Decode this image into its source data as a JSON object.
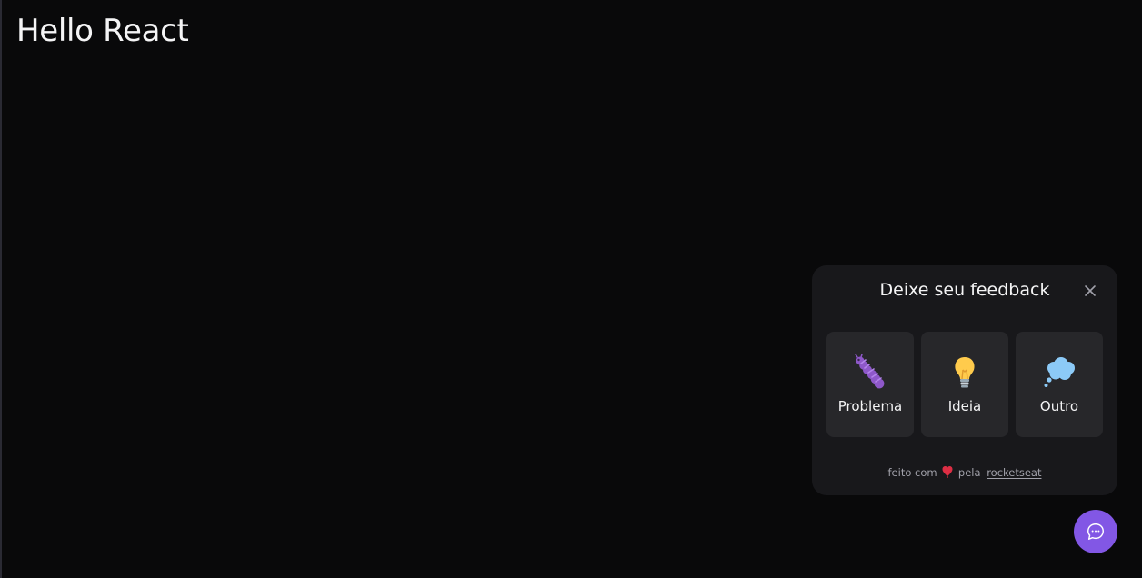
{
  "page": {
    "title": "Hello React"
  },
  "widget": {
    "title": "Deixe seu feedback",
    "options": [
      {
        "label": "Problema",
        "icon": "bug-icon"
      },
      {
        "label": "Ideia",
        "icon": "lightbulb-icon"
      },
      {
        "label": "Outro",
        "icon": "thought-cloud-icon"
      }
    ],
    "footer": {
      "prefix": "feito com",
      "middle": "pela",
      "link": "rocketseat"
    }
  },
  "colors": {
    "background": "#09090a",
    "widget_bg": "#18181b",
    "option_bg": "#27272a",
    "brand": "#8257e5",
    "muted": "#a1a1aa"
  }
}
